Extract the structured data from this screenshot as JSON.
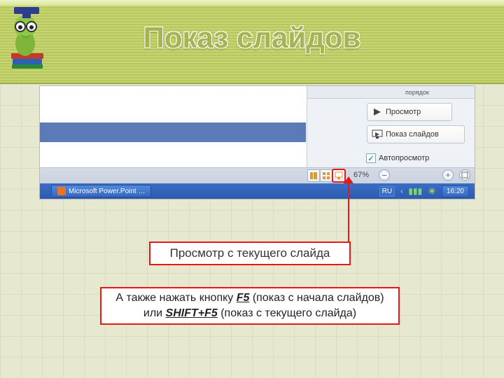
{
  "title": "Показ слайдов",
  "panel": {
    "top_label": "порядок",
    "preview_label": "Просмотр",
    "slideshow_label": "Показ слайдов",
    "autopreview_label": "Автопросмотр",
    "zoom_text": "67%"
  },
  "taskbar": {
    "app_label": "Microsoft Power.Point …",
    "lang": "RU",
    "time": "16:20"
  },
  "callouts": {
    "box1": "Просмотр с текущего слайда",
    "box2_pre": "А также нажать кнопку ",
    "box2_key1": "F5",
    "box2_mid1": " (показ с начала слайдов)",
    "box2_line2_pre": "или ",
    "box2_key2": "SHIFT+F5",
    "box2_mid2": " (показ с текущего слайда)"
  },
  "icons": {
    "play": "▶",
    "check": "✓",
    "plus": "+",
    "minus": "−",
    "caret_left": "‹"
  }
}
